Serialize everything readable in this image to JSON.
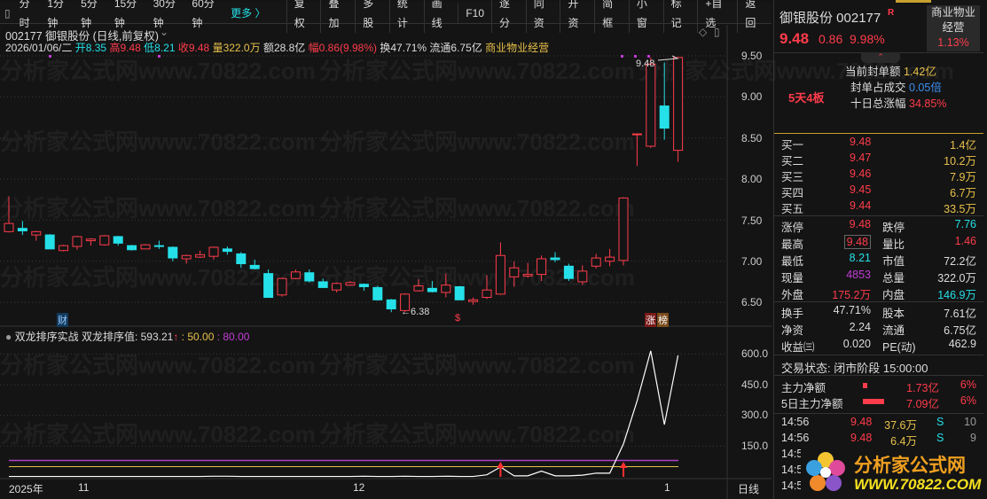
{
  "toolbar": {
    "items": [
      "分时",
      "1分钟",
      "5分钟",
      "15分钟",
      "30分钟",
      "60分钟"
    ],
    "more": "更多 〉",
    "buttons": [
      "复权",
      "叠加",
      "多股",
      "统计",
      "画线",
      "F10",
      "逐分",
      "同资",
      "开资",
      "简框",
      "小窗",
      "标记",
      "+自选",
      "返回"
    ]
  },
  "header": {
    "title": "002177 御银股份 (日线,前复权)",
    "date": "2026/01/06/二",
    "open": "开8.35",
    "high": "高9.48",
    "low": "低8.21",
    "close": "收9.48",
    "vol": "量322.0万",
    "amount": "额28.8亿",
    "change": "幅0.86(9.98%)",
    "turnover": "换47.71%",
    "float": "流通6.75亿",
    "sector": "商业物业经营"
  },
  "watermark": "分析家公式网www.70822.com",
  "price_axis": [
    "9.50",
    "9.00",
    "8.50",
    "8.00",
    "7.50",
    "7.00",
    "6.50"
  ],
  "annotations": {
    "high_label": "9.48",
    "low_label": "6.38",
    "cai": "财",
    "dollar": "$",
    "zhang": "涨",
    "bang": "榜"
  },
  "indicator": {
    "name": "双龙排序实战",
    "value_label": "双龙排序值: 593.21",
    "arrow": "↑",
    "line1": ": 50.00",
    "line2": ": 80.00",
    "axis": [
      "600.0",
      "450.0",
      "300.0",
      "150.0"
    ]
  },
  "time_axis": {
    "year": "2025年",
    "m11": "11",
    "m12": "12",
    "m1": "1",
    "period": "日线"
  },
  "chart_data": {
    "type": "candlestick",
    "ylim": [
      6.3,
      9.6
    ],
    "ohlc": [
      [
        7.36,
        7.46,
        7.79,
        7.35
      ],
      [
        7.4,
        7.37,
        7.49,
        7.32
      ],
      [
        7.32,
        7.36,
        7.37,
        7.25
      ],
      [
        7.32,
        7.15,
        7.33,
        7.15
      ],
      [
        7.13,
        7.19,
        7.2,
        7.12
      ],
      [
        7.18,
        7.3,
        7.31,
        7.14
      ],
      [
        7.25,
        7.27,
        7.28,
        7.19
      ],
      [
        7.2,
        7.31,
        7.32,
        7.19
      ],
      [
        7.3,
        7.22,
        7.31,
        7.19
      ],
      [
        7.19,
        7.14,
        7.2,
        7.13
      ],
      [
        7.15,
        7.2,
        7.21,
        7.15
      ],
      [
        7.19,
        7.18,
        7.25,
        7.15
      ],
      [
        7.17,
        7.04,
        7.18,
        7.0
      ],
      [
        7.03,
        7.07,
        7.08,
        6.97
      ],
      [
        7.05,
        7.08,
        7.13,
        7.04
      ],
      [
        7.06,
        7.17,
        7.18,
        7.02
      ],
      [
        7.15,
        7.12,
        7.18,
        7.08
      ],
      [
        7.09,
        6.97,
        7.11,
        6.92
      ],
      [
        6.95,
        6.91,
        7.02,
        6.9
      ],
      [
        6.85,
        6.56,
        6.9,
        6.56
      ],
      [
        6.59,
        6.79,
        6.8,
        6.57
      ],
      [
        6.79,
        6.87,
        6.9,
        6.78
      ],
      [
        6.86,
        6.76,
        6.9,
        6.74
      ],
      [
        6.75,
        6.68,
        6.79,
        6.68
      ],
      [
        6.65,
        6.73,
        6.74,
        6.62
      ],
      [
        6.71,
        6.74,
        6.76,
        6.7
      ],
      [
        6.72,
        6.69,
        6.73,
        6.64
      ],
      [
        6.68,
        6.53,
        6.7,
        6.52
      ],
      [
        6.53,
        6.42,
        6.54,
        6.38
      ],
      [
        6.4,
        6.6,
        6.61,
        6.38
      ],
      [
        6.64,
        6.7,
        6.78,
        6.63
      ],
      [
        6.67,
        6.63,
        6.76,
        6.62
      ],
      [
        6.62,
        6.71,
        6.85,
        6.56
      ],
      [
        6.69,
        6.53,
        6.7,
        6.53
      ],
      [
        6.51,
        6.53,
        6.56,
        6.47
      ],
      [
        6.56,
        6.65,
        6.83,
        6.54
      ],
      [
        6.6,
        7.07,
        7.23,
        6.59
      ],
      [
        6.81,
        6.92,
        7.0,
        6.69
      ],
      [
        6.82,
        6.84,
        6.98,
        6.8
      ],
      [
        6.84,
        7.03,
        7.07,
        6.76
      ],
      [
        7.04,
        7.02,
        7.11,
        6.99
      ],
      [
        6.94,
        6.79,
        6.97,
        6.76
      ],
      [
        6.75,
        6.88,
        6.95,
        6.71
      ],
      [
        6.94,
        7.04,
        7.09,
        6.91
      ],
      [
        7.0,
        7.05,
        7.15,
        6.94
      ],
      [
        7.01,
        7.77,
        7.78,
        6.95
      ],
      [
        8.55,
        8.55,
        8.55,
        8.16
      ],
      [
        8.4,
        9.4,
        9.48,
        8.38
      ],
      [
        8.89,
        8.62,
        9.42,
        8.48
      ],
      [
        8.35,
        9.48,
        9.48,
        8.21
      ]
    ],
    "indicator_values": [
      2,
      2,
      2,
      2,
      2,
      2,
      2,
      2,
      2,
      2,
      2,
      2,
      2,
      2,
      2,
      3,
      3,
      2,
      2,
      2,
      2,
      2,
      2,
      2,
      2,
      2,
      3,
      2,
      2,
      3,
      2,
      2,
      3,
      2,
      2,
      10,
      48,
      5,
      5,
      28,
      5,
      5,
      8,
      18,
      18,
      160,
      370,
      615,
      255,
      593
    ],
    "indicator_ylim": [
      0,
      650
    ],
    "buy_arrows": [
      36,
      45
    ]
  },
  "right": {
    "name": "御银股份 002177",
    "r_badge": "R",
    "price": "9.48",
    "chg": "0.86",
    "pct": "9.98%",
    "sector1": "商业物业",
    "sector2": "经营",
    "sector_pct": "1.13%",
    "seal_amount_label": "当前封单额",
    "seal_amount": "1.42亿",
    "seal_ratio_label": "封单占成交",
    "seal_ratio": "0.05倍",
    "ten_day_label": "十日总涨幅",
    "ten_day": "34.85%",
    "streak": "5天4板",
    "bids": [
      {
        "l": "买一",
        "p": "9.48",
        "v": "1.4亿"
      },
      {
        "l": "买二",
        "p": "9.47",
        "v": "10.2万"
      },
      {
        "l": "买三",
        "p": "9.46",
        "v": "7.9万"
      },
      {
        "l": "买四",
        "p": "9.45",
        "v": "6.7万"
      },
      {
        "l": "买五",
        "p": "9.44",
        "v": "33.5万"
      }
    ],
    "stats": [
      [
        "涨停",
        "9.48",
        "跌停",
        "7.76"
      ],
      [
        "最高",
        "9.48",
        "量比",
        "1.46"
      ],
      [
        "最低",
        "8.21",
        "市值",
        "72.2亿"
      ],
      [
        "现量",
        "4853",
        "总量",
        "322.0万"
      ],
      [
        "外盘",
        "175.2万",
        "内盘",
        "146.9万"
      ]
    ],
    "stats2": [
      [
        "换手",
        "47.71%",
        "股本",
        "7.61亿"
      ],
      [
        "净资",
        "2.24",
        "流通",
        "6.75亿"
      ],
      [
        "收益㈢",
        "0.020",
        "PE(动)",
        "462.9"
      ]
    ],
    "status": "交易状态: 闭市阶段 15:00:00",
    "flow": [
      {
        "l": "主力净额",
        "v": "1.73亿",
        "p": "6%"
      },
      {
        "l": "5日主力净额",
        "v": "7.09亿",
        "p": "6%"
      }
    ],
    "trades": [
      {
        "t": "14:56",
        "p": "9.48",
        "v": "37.6万",
        "s": "S",
        "n": "10"
      },
      {
        "t": "14:56",
        "p": "9.48",
        "v": "6.4万",
        "s": "S",
        "n": "9"
      },
      {
        "t": "14:5"
      },
      {
        "t": "14:5"
      },
      {
        "t": "14:5"
      }
    ],
    "logo_cn": "分析家公式网",
    "logo_url": "WWW.70822.COM"
  }
}
